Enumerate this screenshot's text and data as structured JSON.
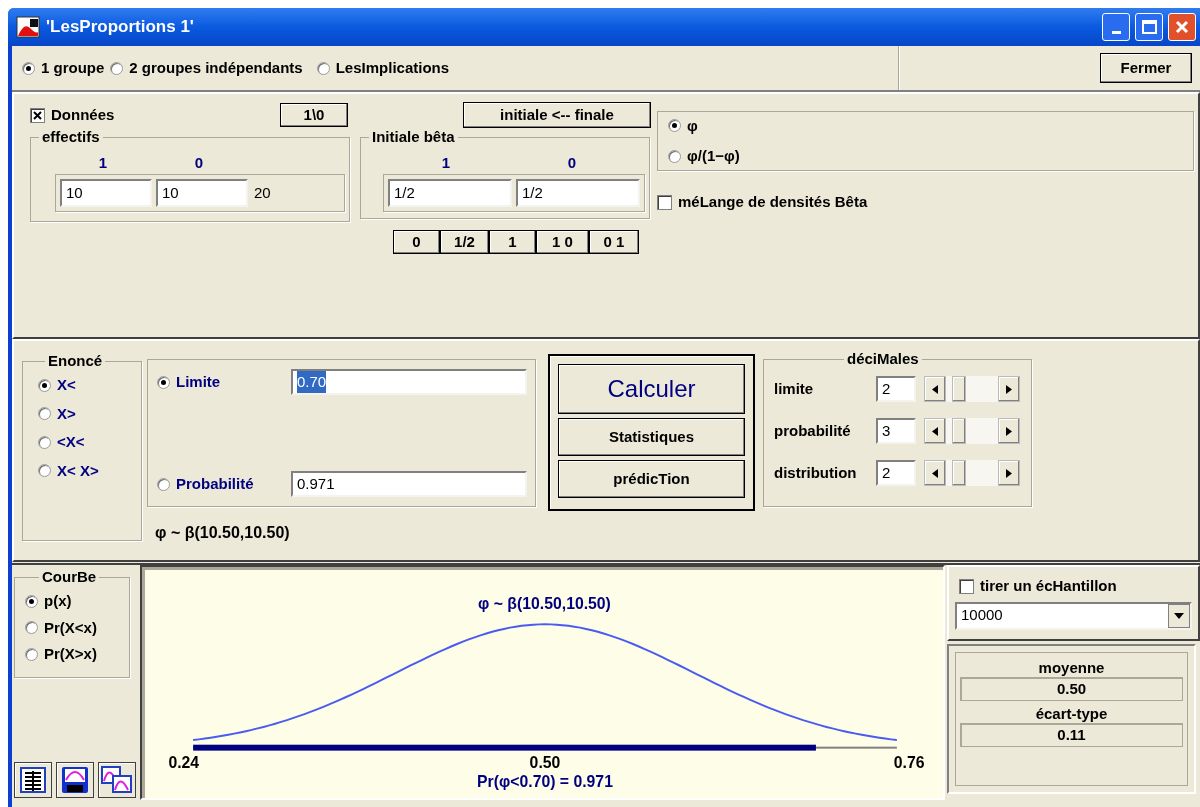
{
  "window": {
    "title": "'LesProportions 1'"
  },
  "mode_options": [
    {
      "label": "1 groupe",
      "selected": true
    },
    {
      "label": "2 groupes indépendants",
      "selected": false
    },
    {
      "label": "LesImplications",
      "selected": false
    }
  ],
  "close_button": "Fermer",
  "data": {
    "checkbox": {
      "label": "Données",
      "checked": true
    },
    "swap_button": "1\\0",
    "copy_button": "initiale <-- finale",
    "counts": {
      "title": "effectifs",
      "headers": [
        "1",
        "0"
      ],
      "values": [
        "10",
        "10"
      ],
      "total": "20"
    },
    "prior": {
      "title": "Initiale bêta",
      "headers": [
        "1",
        "0"
      ],
      "values": [
        "1/2",
        "1/2"
      ],
      "presets": [
        "0",
        "1/2",
        "1",
        "1 0",
        "0 1"
      ]
    },
    "scale_options": [
      {
        "label": "φ",
        "selected": true
      },
      {
        "label": "φ/(1−φ)",
        "selected": false
      }
    ],
    "mixture": {
      "label": "méLange de densités Bêta",
      "checked": false
    }
  },
  "statement": {
    "title": "Enoncé",
    "options": [
      {
        "label": "X<",
        "selected": true
      },
      {
        "label": "X>",
        "selected": false
      },
      {
        "label": "<X<",
        "selected": false
      },
      {
        "label": "X< X>",
        "selected": false
      }
    ],
    "limit": {
      "label": "Limite",
      "selected": true,
      "value": "0.70",
      "highlighted": true
    },
    "probability": {
      "label": "Probabilité",
      "selected": false,
      "value": "0.971"
    },
    "distribution": "φ ~ β(10.50,10.50)"
  },
  "actions": [
    "Calculer",
    "Statistiques",
    "prédicTion"
  ],
  "decimals": {
    "title": "déciMales",
    "rows": [
      {
        "label": "limite",
        "value": "2"
      },
      {
        "label": "probabilité",
        "value": "3"
      },
      {
        "label": "distribution",
        "value": "2"
      }
    ]
  },
  "curve": {
    "title": "CourBe",
    "options": [
      {
        "label": "p(x)",
        "selected": true
      },
      {
        "label": "Pr(X<x)",
        "selected": false
      },
      {
        "label": "Pr(X>x)",
        "selected": false
      }
    ]
  },
  "plot": {
    "title": "φ ~ β(10.50,10.50)",
    "x_labels": [
      "0.24",
      "0.50",
      "0.76"
    ],
    "level": 0.885,
    "caption": "Pr(φ<0.70) = 0.971"
  },
  "sample": {
    "label": "tirer un écHantillon",
    "checked": false,
    "size": "10000"
  },
  "stats": [
    {
      "label": "moyenne",
      "value": "0.50"
    },
    {
      "label": "écart-type",
      "value": "0.11"
    }
  ]
}
